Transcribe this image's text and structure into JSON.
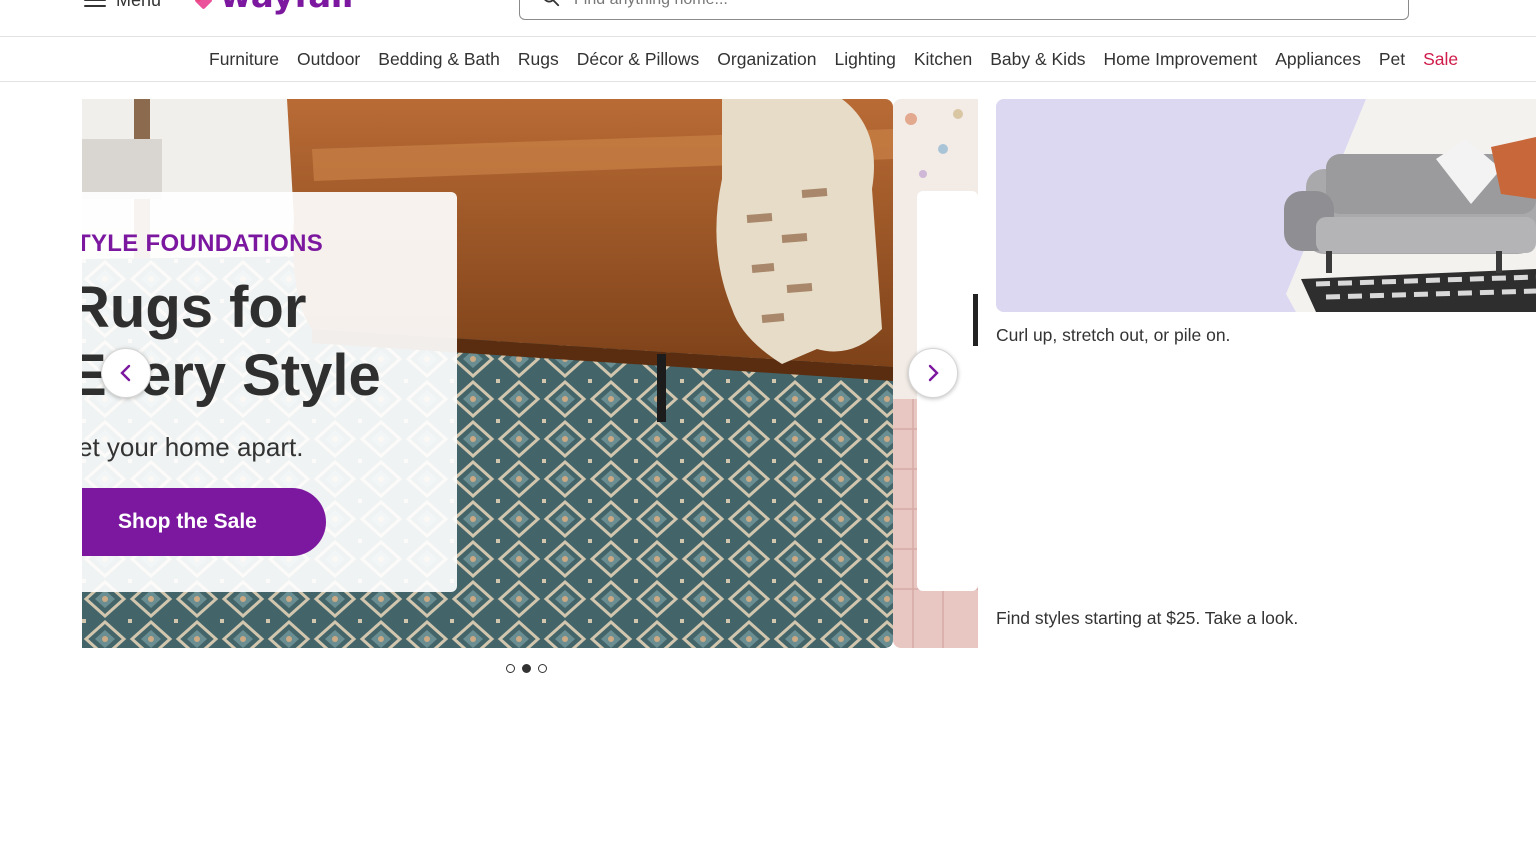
{
  "header": {
    "menu_label": "Menu",
    "logo_text": "wayfair",
    "search_placeholder": "Find anything home..."
  },
  "nav": {
    "items": [
      {
        "label": "Furniture"
      },
      {
        "label": "Outdoor"
      },
      {
        "label": "Bedding & Bath"
      },
      {
        "label": "Rugs"
      },
      {
        "label": "Décor & Pillows"
      },
      {
        "label": "Organization"
      },
      {
        "label": "Lighting"
      },
      {
        "label": "Kitchen"
      },
      {
        "label": "Baby & Kids"
      },
      {
        "label": "Home Improvement"
      },
      {
        "label": "Appliances"
      },
      {
        "label": "Pet"
      },
      {
        "label": "Sale"
      }
    ],
    "sale_color": "#cf1b4a"
  },
  "carousel": {
    "slide": {
      "eyebrow": "TYLE FOUNDATIONS",
      "headline_line1": "Rugs for",
      "headline_line2": "Every Style",
      "subtext": "et your home apart.",
      "cta_label": "Shop the Sale"
    },
    "prev_icon": "chevron-left-icon",
    "next_icon": "chevron-right-icon",
    "dots": {
      "count": 3,
      "active_index": 1
    }
  },
  "side_promos": [
    {
      "caption": "Curl up, stretch out, or pile on."
    },
    {
      "caption": "Find styles starting at $25. Take a look."
    }
  ],
  "colors": {
    "brand_purple": "#7b189f",
    "lavender": "#ddd8f1",
    "text": "#333333"
  }
}
